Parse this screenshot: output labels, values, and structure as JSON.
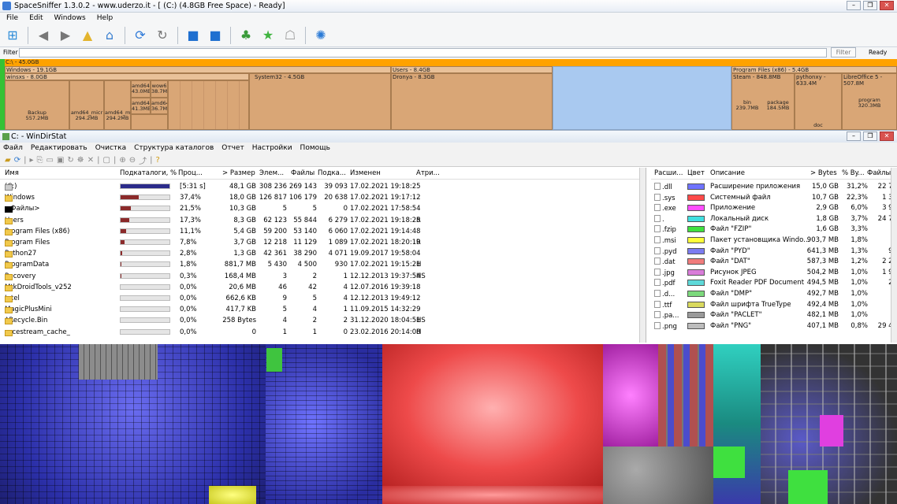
{
  "spacesniffer": {
    "title": "SpaceSniffer 1.3.0.2 - www.uderzo.it - [ (C:) (4.8GB Free Space) - Ready]",
    "menu": [
      "File",
      "Edit",
      "Windows",
      "Help"
    ],
    "filter_label": "Filter",
    "filter_value": "",
    "filter_button": "Filter",
    "status": "Ready",
    "root": "C:\\ - 45.0GB",
    "windows": "Windows - 19.1GB",
    "winsxs": "winsxs - 8.0GB",
    "system32": "System32 - 4.5GB",
    "users": "Users - 8.4GB",
    "dronya": "Dronya - 8.3GB",
    "progfiles": "Program Files (x86) - 5.4GB",
    "steam": "Steam - 848.8MB",
    "pythonxy": "pythonxy - 633.4M",
    "libre": "LibreOffice 5 - 507.8M",
    "cells": {
      "backup": "Backup",
      "backup_size": "557.2MB",
      "a1": "amd64_micr",
      "a1s": "294.2MB",
      "a2": "amd64_micr",
      "a2s": "294.2MB",
      "c1": "amd64",
      "c1s": "43.0MB",
      "c2": "wow6",
      "c2s": "38.7M",
      "c3": "amd64",
      "c3s": "41.3MB",
      "c4": "amd64",
      "c4s": "36.7M",
      "bin": "bin",
      "bin_size": "239.7MB",
      "package": "package",
      "package_size": "184.5MB",
      "program": "program",
      "program_size": "320.3MB",
      "doc": "doc"
    }
  },
  "windirstat": {
    "title": "C: - WinDirStat",
    "menu": [
      "Файл",
      "Редактировать",
      "Очистка",
      "Структура каталогов",
      "Отчет",
      "Настройки",
      "Помощь"
    ],
    "columns": [
      "Имя",
      "Подкаталоги, %",
      "Проц...",
      "> Размер",
      "Элем...",
      "Файлы",
      "Подка...",
      "Изменен",
      "Атри..."
    ],
    "rows": [
      {
        "name": "(C:)",
        "pct": "[5:31 s]",
        "pct_value": 100,
        "size": "48,1 GB",
        "items": "308 236",
        "files": "269 143",
        "subdirs": "39 093",
        "modified": "17.02.2021 19:18:25",
        "attr": ""
      },
      {
        "name": "Windows",
        "pct": "37,4%",
        "pct_value": 37.4,
        "size": "18,0 GB",
        "items": "126 817",
        "files": "106 179",
        "subdirs": "20 638",
        "modified": "17.02.2021 19:17:12",
        "attr": ""
      },
      {
        "name": "<Файлы>",
        "pct": "21,5%",
        "pct_value": 21.5,
        "size": "10,3 GB",
        "items": "5",
        "files": "5",
        "subdirs": "0",
        "modified": "17.02.2021 17:58:54",
        "attr": ""
      },
      {
        "name": "Users",
        "pct": "17,3%",
        "pct_value": 17.3,
        "size": "8,3 GB",
        "items": "62 123",
        "files": "55 844",
        "subdirs": "6 279",
        "modified": "17.02.2021 19:18:25",
        "attr": "R"
      },
      {
        "name": "Program Files (x86)",
        "pct": "11,1%",
        "pct_value": 11.1,
        "size": "5,4 GB",
        "items": "59 200",
        "files": "53 140",
        "subdirs": "6 060",
        "modified": "17.02.2021 19:14:48",
        "attr": ""
      },
      {
        "name": "Program Files",
        "pct": "7,8%",
        "pct_value": 7.8,
        "size": "3,7 GB",
        "items": "12 218",
        "files": "11 129",
        "subdirs": "1 089",
        "modified": "17.02.2021 18:20:19",
        "attr": "R"
      },
      {
        "name": "Python27",
        "pct": "2,8%",
        "pct_value": 2.8,
        "size": "1,3 GB",
        "items": "42 361",
        "files": "38 290",
        "subdirs": "4 071",
        "modified": "19.09.2017 19:58:04",
        "attr": ""
      },
      {
        "name": "ProgramData",
        "pct": "1,8%",
        "pct_value": 1.8,
        "size": "881,7 MB",
        "items": "5 430",
        "files": "4 500",
        "subdirs": "930",
        "modified": "17.02.2021 19:15:21",
        "attr": "H"
      },
      {
        "name": "Recovery",
        "pct": "0,3%",
        "pct_value": 0.3,
        "size": "168,4 MB",
        "items": "3",
        "files": "2",
        "subdirs": "1",
        "modified": "12.12.2013 19:37:54",
        "attr": "HS"
      },
      {
        "name": "MtkDroidTools_v252",
        "pct": "0,0%",
        "pct_value": 0,
        "size": "20,6 MB",
        "items": "46",
        "files": "42",
        "subdirs": "4",
        "modified": "12.07.2016 19:39:18",
        "attr": ""
      },
      {
        "name": "Intel",
        "pct": "0,0%",
        "pct_value": 0,
        "size": "662,6 KB",
        "items": "9",
        "files": "5",
        "subdirs": "4",
        "modified": "12.12.2013 19:49:12",
        "attr": ""
      },
      {
        "name": "MagicPlusMini",
        "pct": "0,0%",
        "pct_value": 0,
        "size": "417,7 KB",
        "items": "5",
        "files": "4",
        "subdirs": "1",
        "modified": "11.09.2015 14:32:29",
        "attr": ""
      },
      {
        "name": "$Recycle.Bin",
        "pct": "0,0%",
        "pct_value": 0,
        "size": "258 Bytes",
        "items": "4",
        "files": "2",
        "subdirs": "2",
        "modified": "31.12.2020 18:04:51",
        "attr": "HS"
      },
      {
        "name": "_acestream_cache_",
        "pct": "0,0%",
        "pct_value": 0,
        "size": "0",
        "items": "1",
        "files": "1",
        "subdirs": "0",
        "modified": "23.02.2016 20:14:08",
        "attr": "H"
      }
    ],
    "ext_columns": [
      "Расши...",
      "Цвет",
      "Описание",
      "> Bytes",
      "% By...",
      "Файлы"
    ],
    "extensions": [
      {
        "ext": ".dll",
        "color": "#6f73ff",
        "desc": "Расширение приложения",
        "bytes": "15,0 GB",
        "pct": "31,2%",
        "files": "22 75"
      },
      {
        "ext": ".sys",
        "color": "#ff4a4a",
        "desc": "Системный файл",
        "bytes": "10,7 GB",
        "pct": "22,3%",
        "files": "1 35"
      },
      {
        "ext": ".exe",
        "color": "#ff4dff",
        "desc": "Приложение",
        "bytes": "2,9 GB",
        "pct": "6,0%",
        "files": "3 98"
      },
      {
        "ext": ".",
        "color": "#3fe0e0",
        "desc": "Локальный диск",
        "bytes": "1,8 GB",
        "pct": "3,7%",
        "files": "24 79"
      },
      {
        "ext": ".fzip",
        "color": "#3fe03f",
        "desc": "Файл \"FZIP\"",
        "bytes": "1,6 GB",
        "pct": "3,3%",
        "files": "3"
      },
      {
        "ext": ".msi",
        "color": "#ffff3a",
        "desc": "Пакет установщика Windo...",
        "bytes": "903,7 MB",
        "pct": "1,8%",
        "files": "8"
      },
      {
        "ext": ".pyd",
        "color": "#7c7cf0",
        "desc": "Файл \"PYD\"",
        "bytes": "641,3 MB",
        "pct": "1,3%",
        "files": "96"
      },
      {
        "ext": ".dat",
        "color": "#f07c7c",
        "desc": "Файл \"DAT\"",
        "bytes": "587,3 MB",
        "pct": "1,2%",
        "files": "2 29"
      },
      {
        "ext": ".jpg",
        "color": "#d97cd9",
        "desc": "Рисунок JPEG",
        "bytes": "504,2 MB",
        "pct": "1,0%",
        "files": "1 93"
      },
      {
        "ext": ".pdf",
        "color": "#5ed9d9",
        "desc": "Foxit Reader PDF Document",
        "bytes": "494,5 MB",
        "pct": "1,0%",
        "files": "25"
      },
      {
        "ext": ".d...",
        "color": "#7cd97c",
        "desc": "Файл \"DMP\"",
        "bytes": "492,7 MB",
        "pct": "1,0%",
        "files": "4"
      },
      {
        "ext": ".ttf",
        "color": "#d9d95e",
        "desc": "Файл шрифта TrueType",
        "bytes": "492,4 MB",
        "pct": "1,0%",
        "files": "1"
      },
      {
        "ext": ".pa...",
        "color": "#9a9a9a",
        "desc": "Файл \"PACLET\"",
        "bytes": "482,1 MB",
        "pct": "1,0%",
        "files": "1"
      },
      {
        "ext": ".png",
        "color": "#bdbdbd",
        "desc": "Файл \"PNG\"",
        "bytes": "407,1 MB",
        "pct": "0,8%",
        "files": "29 48"
      }
    ]
  }
}
